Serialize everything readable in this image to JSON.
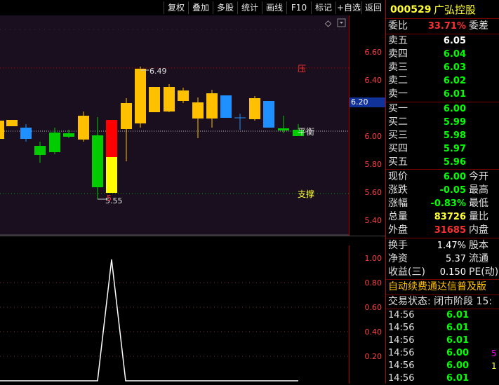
{
  "toolbar": {
    "buttons": [
      "复权",
      "叠加",
      "多股",
      "统计",
      "画线",
      "F10",
      "标记",
      "+自选",
      "返回"
    ]
  },
  "chart": {
    "y_ticks_main": [
      "6.60",
      "6.40",
      "6.20",
      "6.00",
      "5.80",
      "5.60",
      "5.40"
    ],
    "current_price_tag": "6.20",
    "high_label": "6.49",
    "low_label": "5.55",
    "pressure_label": "压",
    "balance_label": "平衡",
    "support_label": "支撑",
    "diamond": "◇",
    "y_ticks_ind": [
      "1.00",
      "0.80",
      "0.60",
      "0.40",
      "0.20"
    ],
    "colors": {
      "up": "#ffc000",
      "down_green": "#00cc00",
      "down_blue": "#1e90ff",
      "red": "#ff0000",
      "yellow": "#ffff00"
    }
  },
  "quote": {
    "code": "000529",
    "name": "广弘控股",
    "weibi_label": "委比",
    "weibi_value": "33.71%",
    "weicha_label": "委差",
    "sell": [
      {
        "label": "卖五",
        "price": "6.05"
      },
      {
        "label": "卖四",
        "price": "6.04"
      },
      {
        "label": "卖三",
        "price": "6.03"
      },
      {
        "label": "卖二",
        "price": "6.02"
      },
      {
        "label": "卖一",
        "price": "6.01"
      }
    ],
    "buy": [
      {
        "label": "买一",
        "price": "6.00"
      },
      {
        "label": "买二",
        "price": "5.99"
      },
      {
        "label": "买三",
        "price": "5.98"
      },
      {
        "label": "买四",
        "price": "5.97"
      },
      {
        "label": "买五",
        "price": "5.96"
      }
    ],
    "stats": [
      {
        "label": "现价",
        "value": "6.00",
        "label2": "今开"
      },
      {
        "label": "涨跌",
        "value": "-0.05",
        "label2": "最高"
      },
      {
        "label": "涨幅",
        "value": "-0.83%",
        "label2": "最低"
      },
      {
        "label": "总量",
        "value": "83726",
        "label2": "量比"
      },
      {
        "label": "外盘",
        "value": "31685",
        "label2": "内盘"
      }
    ],
    "extra": [
      {
        "label": "换手",
        "value": "1.47%",
        "label2": "股本"
      },
      {
        "label": "净资",
        "value": "5.37",
        "label2": "流通"
      },
      {
        "label": "收益(三)",
        "value": "0.150",
        "label2": "PE(动)"
      }
    ],
    "news": "自动续费通达信普及版",
    "status": "交易状态: 闭市阶段 15:",
    "ticks": [
      {
        "time": "14:56",
        "price": "6.01",
        "vol": ""
      },
      {
        "time": "14:56",
        "price": "6.01",
        "vol": ""
      },
      {
        "time": "14:56",
        "price": "6.01",
        "vol": ""
      },
      {
        "time": "14:56",
        "price": "6.00",
        "vol": "5"
      },
      {
        "time": "14:56",
        "price": "6.00",
        "vol": "1"
      },
      {
        "time": "14:56",
        "price": "6.01",
        "vol": ""
      }
    ]
  }
}
